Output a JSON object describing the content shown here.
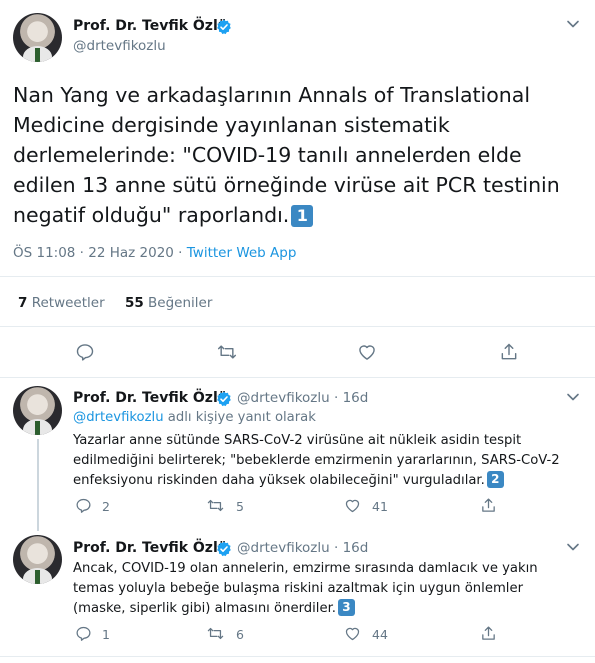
{
  "main_tweet": {
    "name": "Prof. Dr. Tevfik Özlü",
    "handle": "@drtevfikozlu",
    "text": "Nan Yang ve arkadaşlarının Annals of Translational Medicine dergisinde yayınlanan sistematik derlemelerinde: \"COVID-19 tanılı annelerden elde edilen 13 anne sütü örneğinde virüse ait PCR testinin negatif olduğu\" raporlandı.",
    "badge": "1",
    "timestamp": "ÖS 11:08 · 22 Haz 2020 · ",
    "source": "Twitter Web App",
    "retweets_count": "7",
    "retweets_label": "Retweetler",
    "likes_count": "55",
    "likes_label": "Beğeniler"
  },
  "replies": [
    {
      "name": "Prof. Dr. Tevfik Özlü",
      "meta": "@drtevfikozlu · 16d",
      "reply_to_handle": "@drtevfikozlu",
      "reply_to_suffix": " adlı kişiye yanıt olarak",
      "text": "Yazarlar anne sütünde SARS-CoV-2 virüsüne ait nükleik asidin tespit edilmediğini belirterek; \"bebeklerde emzirmenin yararlarının, SARS-CoV-2 enfeksiyonu riskinden daha yüksek olabileceğini\" vurguladılar.",
      "badge": "2",
      "reply_count": "2",
      "retweet_count": "5",
      "like_count": "41"
    },
    {
      "name": "Prof. Dr. Tevfik Özlü",
      "meta": "@drtevfikozlu · 16d",
      "text": "Ancak, COVID-19 olan annelerin, emzirme sırasında damlacık ve yakın temas yoluyla bebeğe bulaşma riskini azaltmak için uygun önlemler (maske, siperlik gibi) almasını önerdiler.",
      "badge": "3",
      "reply_count": "1",
      "retweet_count": "6",
      "like_count": "44"
    }
  ],
  "colors": {
    "accent": "#1b95e0",
    "secondary_text": "#657786",
    "badge_blue": "#3b88c3",
    "divider": "#e6ecf0"
  },
  "icons": [
    "verified-badge-icon",
    "chevron-down-icon",
    "reply-icon",
    "retweet-icon",
    "like-icon",
    "share-icon"
  ]
}
